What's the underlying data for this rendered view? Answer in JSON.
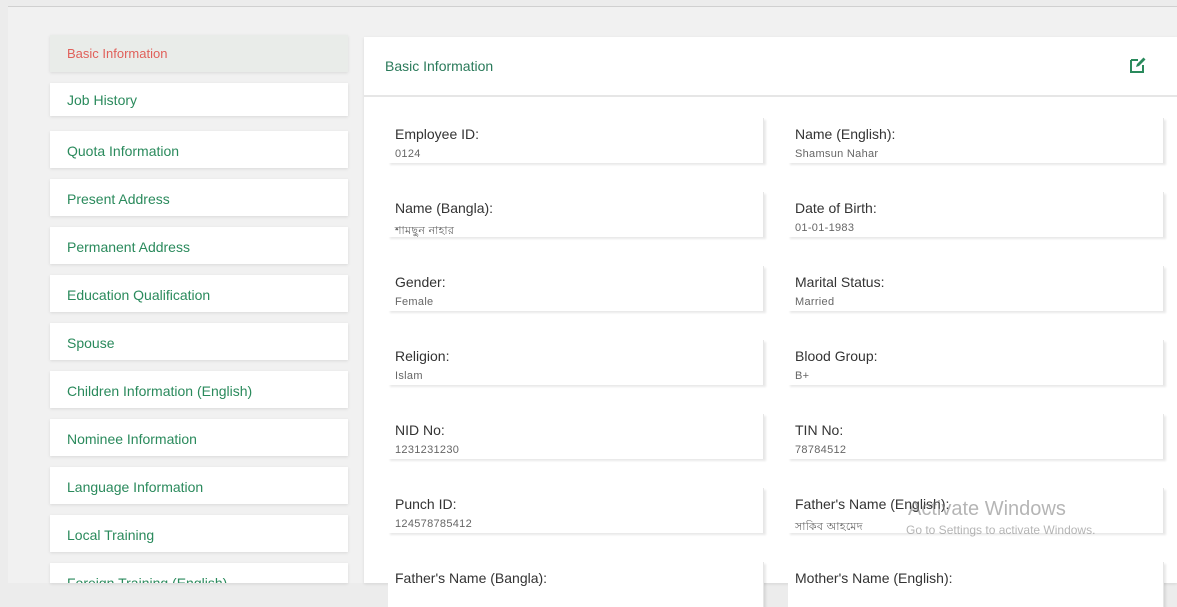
{
  "sidebar": {
    "items": [
      {
        "label": "Basic Information"
      },
      {
        "label": "Job History"
      },
      {
        "label": "Quota Information"
      },
      {
        "label": "Present Address"
      },
      {
        "label": "Permanent Address"
      },
      {
        "label": "Education Qualification"
      },
      {
        "label": "Spouse"
      },
      {
        "label": "Children Information (English)"
      },
      {
        "label": "Nominee Information"
      },
      {
        "label": "Language Information"
      },
      {
        "label": "Local Training"
      },
      {
        "label": "Foreign Training (English)"
      }
    ]
  },
  "panel": {
    "title": "Basic Information",
    "edit_icon": "edit-icon",
    "fields": [
      {
        "label": "Employee ID:",
        "value": "0124"
      },
      {
        "label": "Name (English):",
        "value": "Shamsun Nahar"
      },
      {
        "label": "Name (Bangla):",
        "value": "শামছুন নাহার"
      },
      {
        "label": "Date of Birth:",
        "value": "01-01-1983"
      },
      {
        "label": "Gender:",
        "value": "Female"
      },
      {
        "label": "Marital Status:",
        "value": "Married"
      },
      {
        "label": "Religion:",
        "value": "Islam"
      },
      {
        "label": "Blood Group:",
        "value": "B+"
      },
      {
        "label": "NID No:",
        "value": "1231231230"
      },
      {
        "label": "TIN No:",
        "value": "78784512"
      },
      {
        "label": "Punch ID:",
        "value": "124578785412"
      },
      {
        "label": "Father's Name (English):",
        "value": "সাকিব আহমেদ"
      },
      {
        "label": "Father's Name (Bangla):",
        "value": ""
      },
      {
        "label": "Mother's Name (English):",
        "value": ""
      }
    ]
  },
  "watermark": {
    "line1": "Activate Windows",
    "line2": "Go to Settings to activate Windows."
  },
  "colors": {
    "accent_green": "#2a8a5c",
    "active_red": "#e0605a"
  }
}
